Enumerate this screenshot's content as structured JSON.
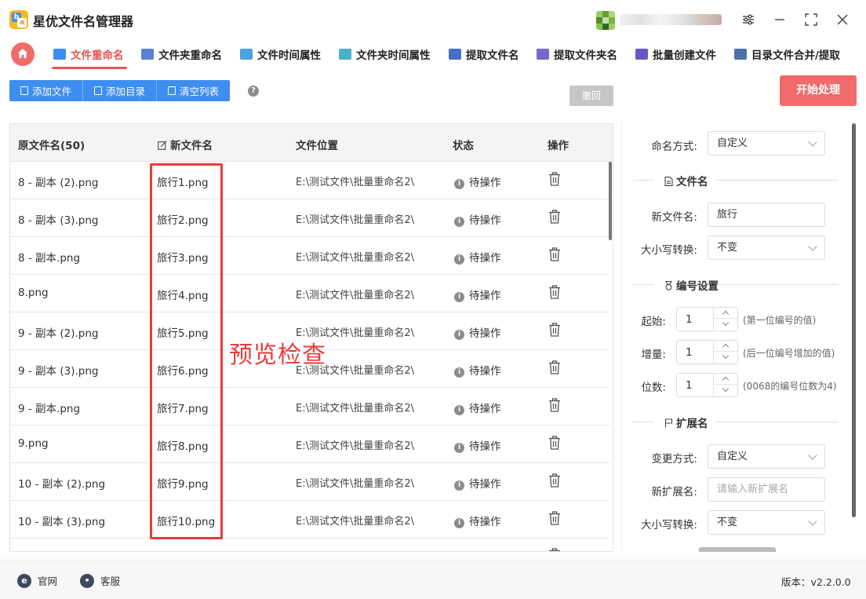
{
  "app": {
    "title": "星优文件名管理器",
    "logo_letters": [
      "b",
      "a"
    ],
    "user_name_blurred": true
  },
  "tabs": [
    {
      "label": "文件重命名",
      "active": true,
      "icon": "image-file-icon",
      "color": "#3d8ef0"
    },
    {
      "label": "文件夹重命名",
      "active": false,
      "icon": "folder-card-icon",
      "color": "#5c7fd6"
    },
    {
      "label": "文件时间属性",
      "active": false,
      "icon": "file-time-icon",
      "color": "#4aa3df"
    },
    {
      "label": "文件夹时间属性",
      "active": false,
      "icon": "folder-time-icon",
      "color": "#4ab1c9"
    },
    {
      "label": "提取文件名",
      "active": false,
      "icon": "extract-name-icon",
      "color": "#4670c7"
    },
    {
      "label": "提取文件夹名",
      "active": false,
      "icon": "extract-folder-icon",
      "color": "#7a68c9"
    },
    {
      "label": "批量创建文件",
      "active": false,
      "icon": "batch-create-icon",
      "color": "#6a55c2"
    },
    {
      "label": "目录文件合并/提取",
      "active": false,
      "icon": "merge-folder-icon",
      "color": "#4f6fa8"
    }
  ],
  "toolbar": {
    "add_file": "添加文件",
    "add_dir": "添加目录",
    "clear_list": "清空列表",
    "help": "?",
    "undo": "撤回",
    "start": "开始处理"
  },
  "table": {
    "headers": {
      "original": "原文件名(50)",
      "new_name": "新文件名",
      "location": "文件位置",
      "status": "状态",
      "action": "操作"
    },
    "rows": [
      {
        "original": "8 - 副本 (2).png",
        "new_name": "旅行1.png",
        "location": "E:\\测试文件\\批量重命名2\\",
        "status": "待操作"
      },
      {
        "original": "8 - 副本 (3).png",
        "new_name": "旅行2.png",
        "location": "E:\\测试文件\\批量重命名2\\",
        "status": "待操作"
      },
      {
        "original": "8 - 副本.png",
        "new_name": "旅行3.png",
        "location": "E:\\测试文件\\批量重命名2\\",
        "status": "待操作"
      },
      {
        "original": "8.png",
        "new_name": "旅行4.png",
        "location": "E:\\测试文件\\批量重命名2\\",
        "status": "待操作"
      },
      {
        "original": "9 - 副本 (2).png",
        "new_name": "旅行5.png",
        "location": "E:\\测试文件\\批量重命名2\\",
        "status": "待操作"
      },
      {
        "original": "9 - 副本 (3).png",
        "new_name": "旅行6.png",
        "location": "E:\\测试文件\\批量重命名2\\",
        "status": "待操作"
      },
      {
        "original": "9 - 副本.png",
        "new_name": "旅行7.png",
        "location": "E:\\测试文件\\批量重命名2\\",
        "status": "待操作"
      },
      {
        "original": "9.png",
        "new_name": "旅行8.png",
        "location": "E:\\测试文件\\批量重命名2\\",
        "status": "待操作"
      },
      {
        "original": "10 - 副本 (2).png",
        "new_name": "旅行9.png",
        "location": "E:\\测试文件\\批量重命名2\\",
        "status": "待操作"
      },
      {
        "original": "10 - 副本 (3).png",
        "new_name": "旅行10.png",
        "location": "E:\\测试文件\\批量重命名2\\",
        "status": "待操作"
      }
    ]
  },
  "annotation": "预览检查",
  "settings": {
    "naming_mode": {
      "label": "命名方式:",
      "value": "自定义"
    },
    "section_filename": "文件名",
    "new_filename": {
      "label": "新文件名:",
      "value": "旅行"
    },
    "case_convert": {
      "label": "大小写转换:",
      "value": "不变"
    },
    "section_number": "编号设置",
    "start": {
      "label": "起始:",
      "value": "1",
      "hint": "(第一位编号的值)"
    },
    "increment": {
      "label": "增量:",
      "value": "1",
      "hint": "(后一位编号增加的值)"
    },
    "digits": {
      "label": "位数:",
      "value": "1",
      "hint": "(0068的编号位数为4)"
    },
    "section_ext": "扩展名",
    "change_mode": {
      "label": "变更方式:",
      "value": "自定义"
    },
    "new_ext": {
      "label": "新扩展名:",
      "placeholder": "请输入新扩展名"
    },
    "ext_case": {
      "label": "大小写转换:",
      "value": "不变"
    }
  },
  "statusbar": {
    "website": "官网",
    "support": "客服",
    "version": "版本：v2.2.0.0"
  },
  "colors": {
    "accent_red": "#ec5454",
    "primary_blue": "#3d8ef0",
    "start_button": "#f26b6b",
    "annotation_red": "#e83c3c"
  }
}
